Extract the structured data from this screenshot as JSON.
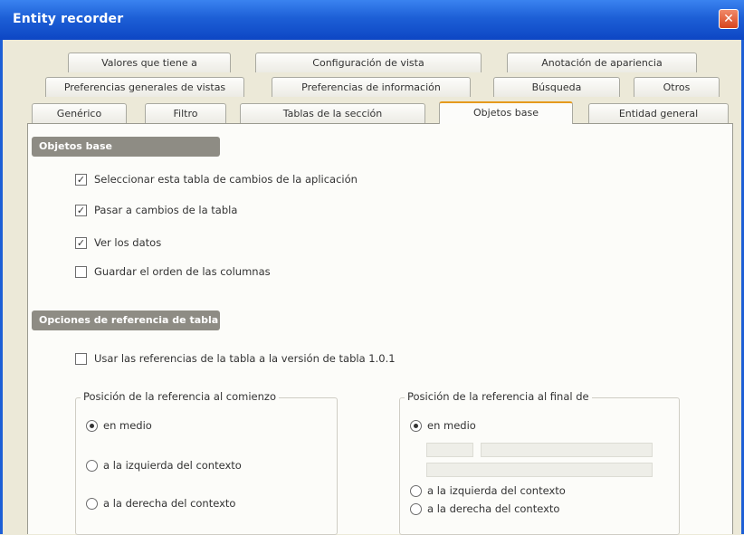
{
  "window": {
    "title": "Entity recorder",
    "close_glyph": "✕",
    "accent": "#1d5fd6"
  },
  "tabs": {
    "row1": [
      "Valores que tiene a",
      "Configuración de vista",
      "Anotación de apariencia"
    ],
    "row2": [
      "Preferencias generales de vistas",
      "Preferencias de información",
      "Búsqueda",
      "Otros"
    ],
    "row3": [
      "Genérico",
      "Filtro",
      "Tablas de la sección",
      "Objetos base",
      "Entidad general"
    ],
    "active": "Objetos base"
  },
  "section1": {
    "header": "Objetos base",
    "options": [
      {
        "label": "Seleccionar esta tabla de cambios de la aplicación",
        "checked": true
      },
      {
        "label": "Pasar a cambios de la tabla",
        "checked": true
      },
      {
        "label": "Ver los datos",
        "checked": true
      },
      {
        "label": "Guardar el orden de las columnas",
        "checked": false
      }
    ]
  },
  "section2": {
    "header": "Opciones de referencia de tabla",
    "checkbox_label": "Usar las referencias de la tabla a la versión de tabla 1.0.1",
    "checkbox_checked": false,
    "group_left": {
      "title": "Posición de la referencia al comienzo",
      "options": [
        {
          "label": "en medio",
          "selected": true
        },
        {
          "label": "a la izquierda del contexto",
          "selected": false
        },
        {
          "label": "a la derecha del contexto",
          "selected": false
        }
      ]
    },
    "group_right": {
      "title": "Posición de la referencia al final de",
      "options": [
        {
          "label": "en medio",
          "selected": true
        },
        {
          "label": "a la izquierda del contexto",
          "selected": false
        },
        {
          "label": "a la derecha del contexto",
          "selected": false
        }
      ]
    }
  }
}
